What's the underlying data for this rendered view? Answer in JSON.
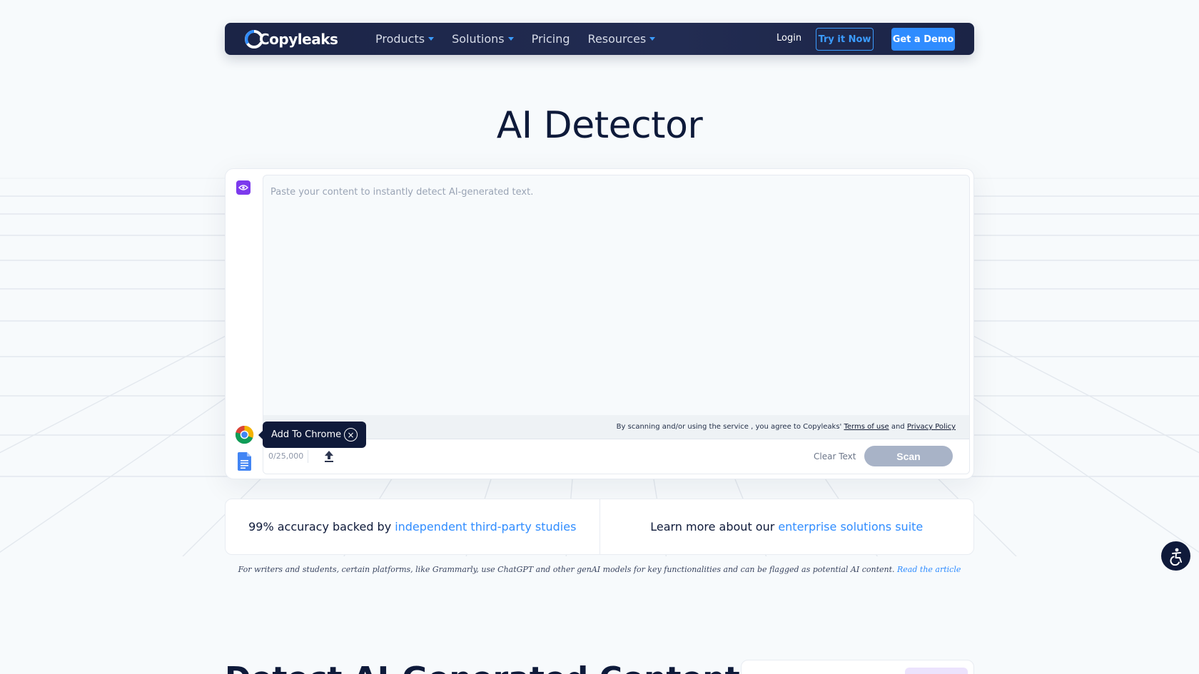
{
  "nav": {
    "logo_text": "Copyleaks",
    "menu": [
      {
        "label": "Products",
        "has_dropdown": true
      },
      {
        "label": "Solutions",
        "has_dropdown": true
      },
      {
        "label": "Pricing",
        "has_dropdown": false
      },
      {
        "label": "Resources",
        "has_dropdown": true
      }
    ],
    "login_label": "Login",
    "try_label": "Try it Now",
    "demo_label": "Get a Demo"
  },
  "page_title": "AI Detector",
  "detector": {
    "placeholder": "Paste your content to instantly detect AI-generated text.",
    "terms_prefix": "By scanning and/or using the service , you agree to Copyleaks'",
    "terms_link": "Terms of use",
    "terms_and": "and",
    "privacy_link": "Privacy Policy",
    "char_counter": "0/25,000",
    "clear_label": "Clear Text",
    "scan_label": "Scan",
    "chrome_tip_label": "Add To Chrome",
    "icons": [
      "eye-icon",
      "chrome-icon",
      "google-docs-icon",
      "upload-icon",
      "close-icon"
    ]
  },
  "info": {
    "left_text": "99% accuracy backed by",
    "left_link": "independent third-party studies",
    "right_text": "Learn more about our",
    "right_link": "enterprise solutions suite"
  },
  "note": {
    "text": "For writers and students, certain platforms, like Grammarly, use ChatGPT and other genAI models for key functionalities and can be flagged as potential AI content.",
    "link": "Read the article"
  },
  "bottom_heading": "Detect AI-Generated Content",
  "colors": {
    "nav_bg": "#1b2446",
    "accent": "#2f8cff",
    "title": "#0e1a3a",
    "eye_button": "#7c3aed",
    "scan_disabled": "#a8b3c7"
  }
}
